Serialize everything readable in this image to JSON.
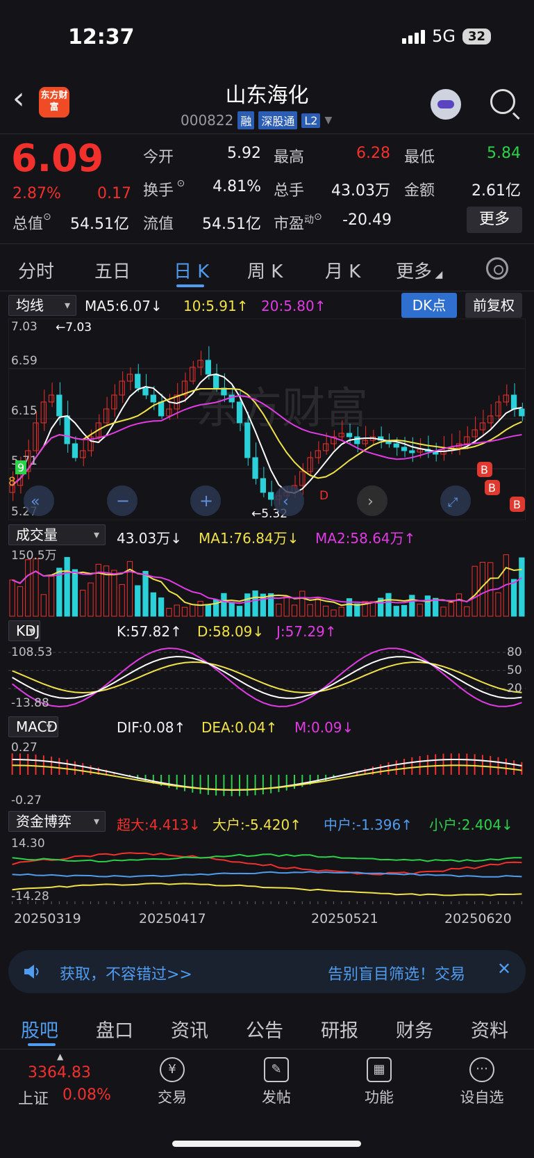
{
  "status": {
    "time": "12:37",
    "network": "5G",
    "battery": "32"
  },
  "header": {
    "logo": "东方财富",
    "stock_name": "山东海化",
    "stock_code": "000822",
    "tags": [
      "融",
      "深股通",
      "L2"
    ]
  },
  "quote": {
    "price": "6.09",
    "pct": "2.87%",
    "chg": "0.17",
    "open_label": "今开",
    "open": "5.92",
    "high_label": "最高",
    "high": "6.28",
    "low_label": "最低",
    "low": "5.84",
    "turnover_label": "换手",
    "turnover": "4.81%",
    "volume_label": "总手",
    "volume": "43.03万",
    "amount_label": "金额",
    "amount": "2.61亿",
    "mktcap_label": "总值",
    "mktcap": "54.51亿",
    "float_label": "流值",
    "float": "54.51亿",
    "pe_label": "市盈",
    "pe_sup": "动",
    "pe": "-20.49",
    "more": "更多"
  },
  "period_tabs": [
    "分时",
    "五日",
    "日 K",
    "周 K",
    "月 K",
    "更多"
  ],
  "ma_header": {
    "select": "均线",
    "ma5": "MA5:6.07↓",
    "ma10": "10:5.91↑",
    "ma20": "20:5.80↑",
    "dk": "DK点",
    "fq": "前复权"
  },
  "kline": {
    "y_ticks": [
      "7.03",
      "6.59",
      "6.15",
      "5.71",
      "5.27"
    ],
    "high_marker": "←7.03",
    "low_marker": "←5.32",
    "side_nums": [
      "9",
      "8"
    ],
    "d_label": "D",
    "b_label": "B"
  },
  "vol_header": {
    "select": "成交量",
    "vol": "43.03万↓",
    "ma1": "MA1:76.84万↓",
    "ma2": "MA2:58.64万↑",
    "ymax": "150.5万"
  },
  "kdj_header": {
    "select": "KDJ",
    "k": "K:57.82↑",
    "d": "D:58.09↓",
    "j": "J:57.29↑",
    "ymax": "108.53",
    "ymin": "-13.88",
    "levels": [
      "80",
      "50",
      "20"
    ]
  },
  "macd_header": {
    "select": "MACD",
    "dif": "DIF:0.08↑",
    "dea": "DEA:0.04↑",
    "m": "M:0.09↓",
    "ymax": "0.27",
    "ymin": "-0.27"
  },
  "fund_header": {
    "select": "资金博弈",
    "super": "超大:4.413↓",
    "large": "大户:-5.420↑",
    "mid": "中户:-1.396↑",
    "small": "小户:2.404↓",
    "ymax": "14.30",
    "ymin": "-14.28"
  },
  "dates": [
    "20250319",
    "20250417",
    "20250521",
    "20250620"
  ],
  "ad": {
    "left": "获取，不容错过>>",
    "right": "告别盲目筛选！交易"
  },
  "bottom_tabs": [
    "股吧",
    "盘口",
    "资讯",
    "公告",
    "研报",
    "财务",
    "资料"
  ],
  "index": {
    "value": "3364.83",
    "name": "上证",
    "pct": "0.08%"
  },
  "nav": [
    "交易",
    "发帖",
    "功能",
    "设自选"
  ],
  "colors": {
    "up": "#f2302c",
    "down": "#2bd1d8",
    "ma5": "#ffffff",
    "ma10": "#f1e24a",
    "ma20": "#e13be4",
    "accent": "#4f9cf0"
  }
}
